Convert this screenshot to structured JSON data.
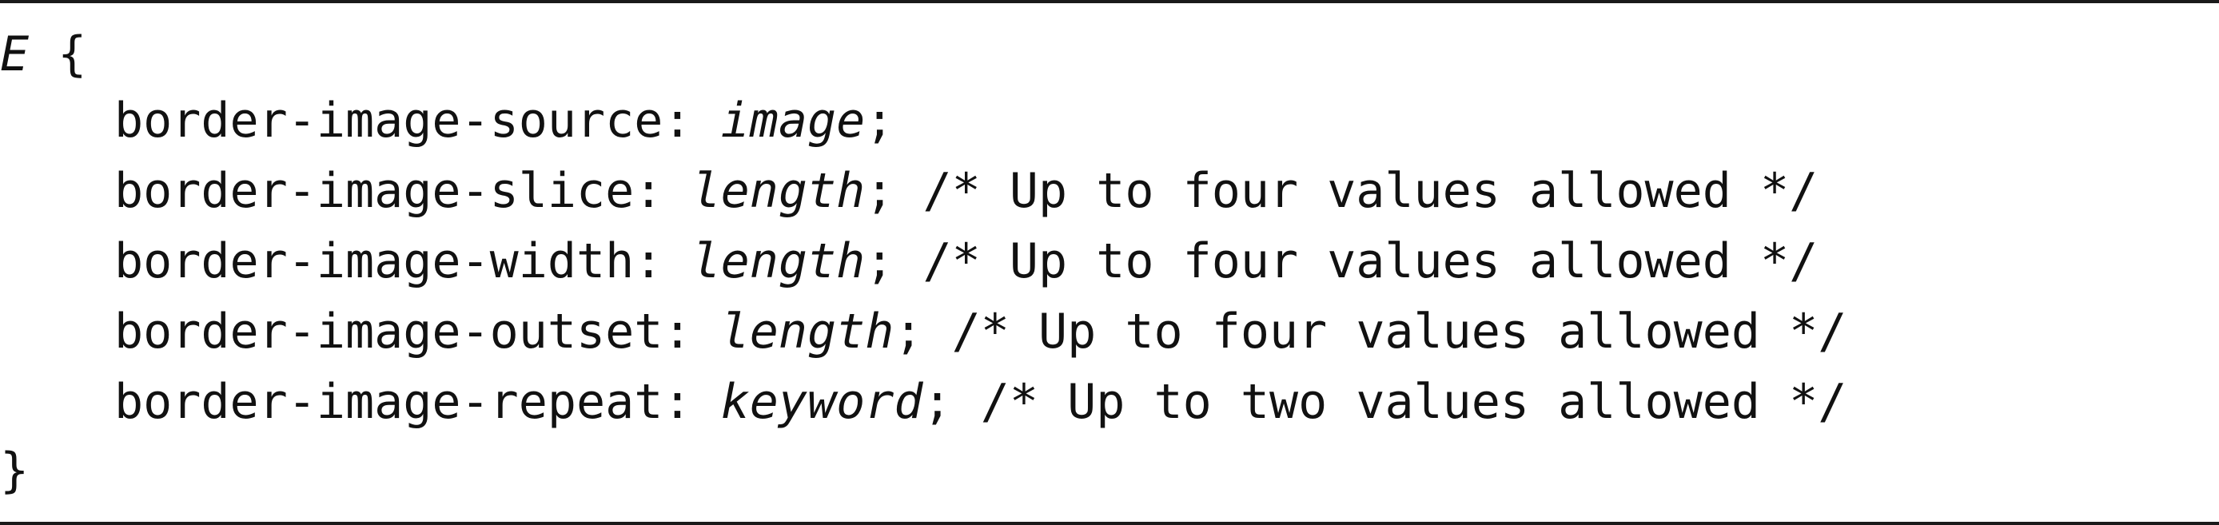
{
  "code": {
    "selector": "E",
    "open_brace": " {",
    "close_brace": "}",
    "lines": [
      {
        "property": "border-image-source: ",
        "value": "image",
        "suffix": ";"
      },
      {
        "property": "border-image-slice: ",
        "value": "length",
        "suffix": "; /* Up to four values allowed */"
      },
      {
        "property": "border-image-width: ",
        "value": "length",
        "suffix": "; /* Up to four values allowed */"
      },
      {
        "property": "border-image-outset: ",
        "value": "length",
        "suffix": "; /* Up to four values allowed */"
      },
      {
        "property": "border-image-repeat: ",
        "value": "keyword",
        "suffix": "; /* Up to two values allowed */"
      }
    ]
  }
}
